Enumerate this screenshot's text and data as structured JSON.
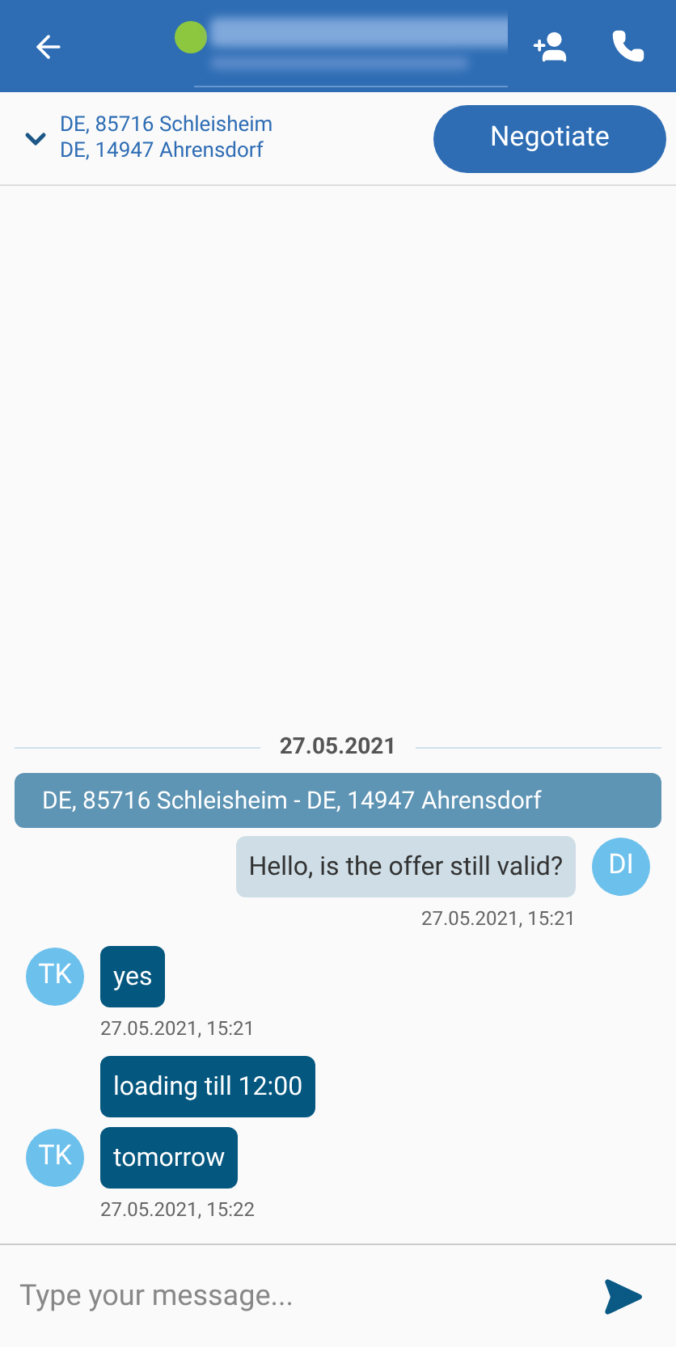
{
  "header": {
    "online": true
  },
  "route": {
    "from": "DE, 85716 Schleisheim",
    "to": "DE, 14947 Ahrensdorf",
    "action": "Negotiate"
  },
  "chat": {
    "date": "27.05.2021",
    "route_banner": "DE, 85716 Schleisheim - DE, 14947 Ahrensdorf",
    "messages": [
      {
        "kind": "outgoing",
        "text": "Hello, is the offer still valid?",
        "avatar": "DI",
        "time": "27.05.2021, 15:21"
      },
      {
        "kind": "incoming",
        "text": "yes",
        "avatar": "TK",
        "time": "27.05.2021, 15:21"
      },
      {
        "kind": "incoming",
        "text": "loading till 12:00"
      },
      {
        "kind": "incoming",
        "text": "tomorrow",
        "avatar": "TK",
        "time": "27.05.2021, 15:22"
      }
    ]
  },
  "composer": {
    "placeholder": "Type your message..."
  }
}
